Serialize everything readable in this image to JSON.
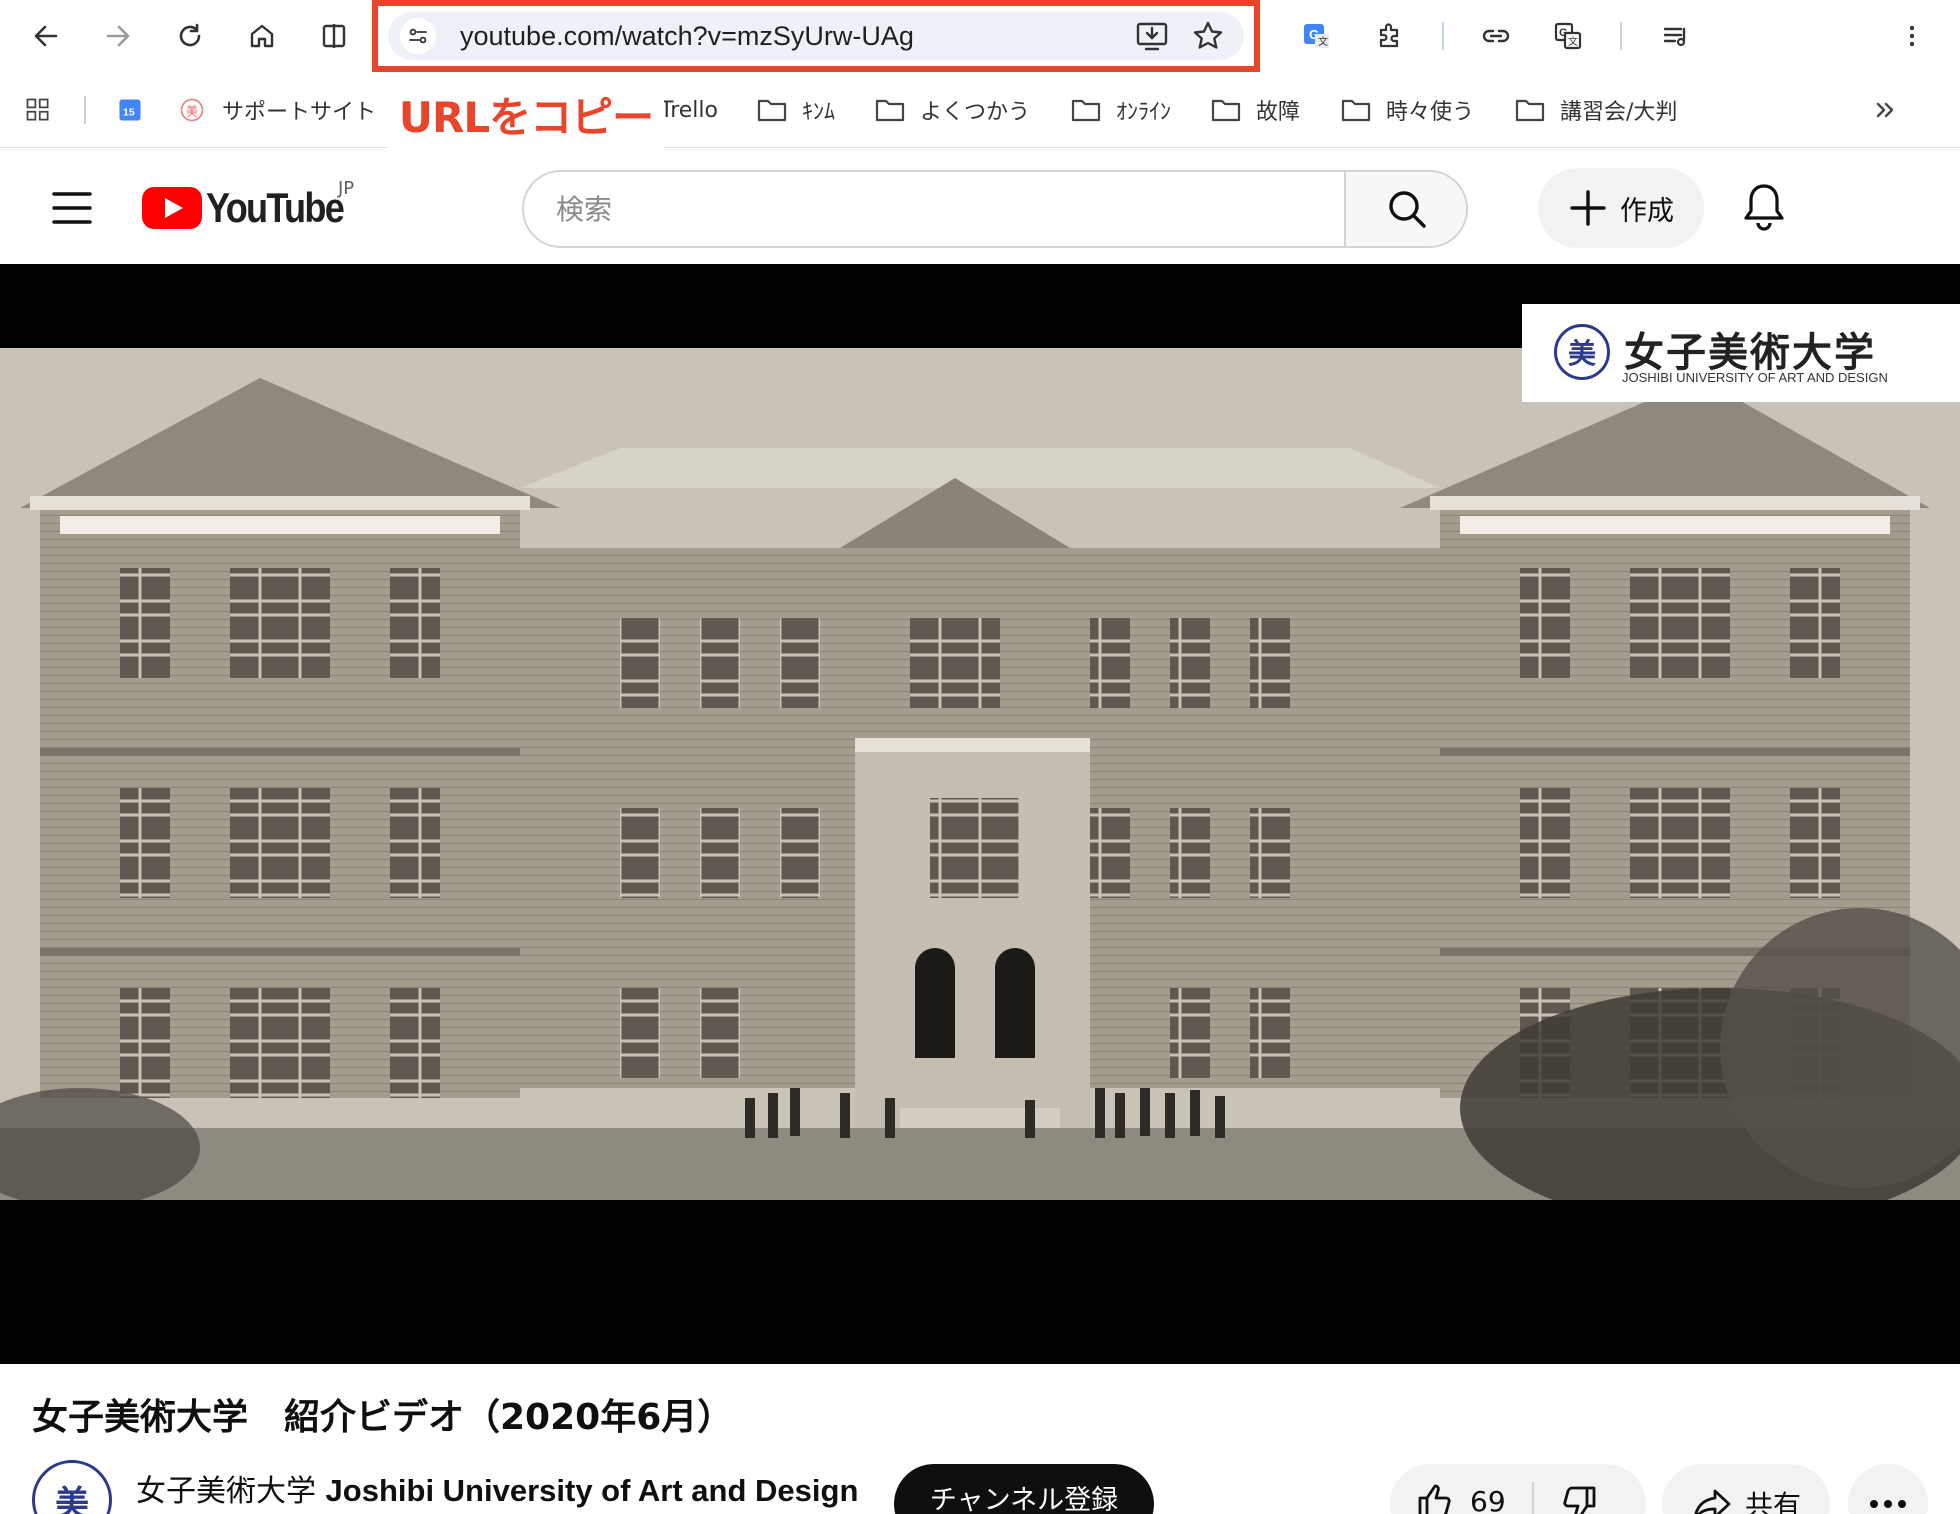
{
  "browser": {
    "url": "youtube.com/watch?v=mzSyUrw-UAg",
    "colors": {
      "highlight": "#e8452c",
      "omnibox_bg": "#eef1f8"
    }
  },
  "bookmarks": {
    "items": [
      {
        "label": "",
        "icon": "calendar-icon",
        "badge": "15"
      },
      {
        "label": "サポートサイト",
        "icon": "joshibi-icon"
      },
      {
        "label": "Trello",
        "icon": "folder-icon"
      },
      {
        "label": "ｷﾝﾑ",
        "icon": "folder-icon"
      },
      {
        "label": "よくつかう",
        "icon": "folder-icon"
      },
      {
        "label": "ｵﾝﾗｲﾝ",
        "icon": "folder-icon"
      },
      {
        "label": "故障",
        "icon": "folder-icon"
      },
      {
        "label": "時々使う",
        "icon": "folder-icon"
      },
      {
        "label": "講習会/大判",
        "icon": "folder-icon"
      }
    ]
  },
  "annotation": {
    "copy_url": "URLをコピー"
  },
  "youtube": {
    "logo_text": "YouTube",
    "country": "JP",
    "search_placeholder": "検索",
    "create_label": "作成",
    "colors": {
      "brand": "#ff0000"
    }
  },
  "video": {
    "overlay_logo": {
      "ja": "女子美術大学",
      "en": "JOSHIBI UNIVERSITY OF ART AND DESIGN",
      "seal": "美"
    },
    "title": "女子美術大学　紹介ビデオ（2020年6月）",
    "channel": {
      "name_ja": "女子美術大学",
      "name_en": "Joshibi University of Art and Design",
      "avatar": "美"
    },
    "subscribe_label": "チャンネル登録",
    "likes": "69",
    "share_label": "共有"
  }
}
